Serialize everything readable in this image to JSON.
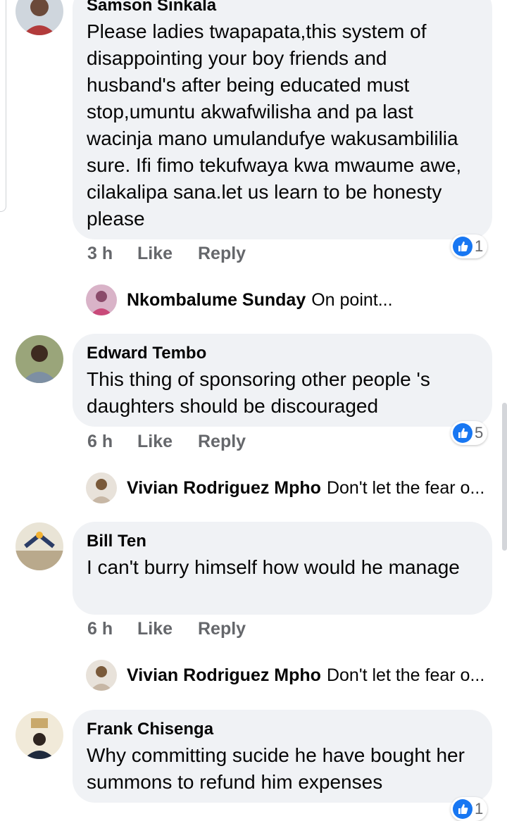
{
  "comments": [
    {
      "author": "Samson Sinkala",
      "text": "Please ladies twapapata,this system of disappointing your boy friends and husband's after being educated must stop,umuntu akwafwilisha and pa last wacinja mano umulandufye wakusambililia sure. Ifi fimo tekufwaya kwa mwaume awe, cilakalipa sana.let us learn to be honesty please",
      "time": "3 h",
      "like": "Like",
      "reply": "Reply",
      "reactions": "1",
      "reply_preview": {
        "name": "Nkombalume Sunday",
        "text": "On point..."
      }
    },
    {
      "author": "Edward Tembo",
      "text": "This thing of sponsoring other people 's daughters should be discouraged",
      "time": "6 h",
      "like": "Like",
      "reply": "Reply",
      "reactions": "5",
      "reply_preview": {
        "name": "Vivian Rodriguez Mpho",
        "text": "Don't let the fear o..."
      }
    },
    {
      "author": "Bill Ten",
      "text": "I can't burry himself how would he manage",
      "time": "6 h",
      "like": "Like",
      "reply": "Reply",
      "reply_preview": {
        "name": "Vivian Rodriguez Mpho",
        "text": "Don't let the fear o..."
      }
    },
    {
      "author": "Frank Chisenga",
      "text": "Why committing sucide he have bought her summons to refund him expenses",
      "reactions": "1"
    }
  ],
  "colors": {
    "bubble": "#f0f2f5",
    "meta": "#65676b",
    "like_blue": "#1877f2"
  },
  "icons": {
    "reaction": "like-thumb-icon"
  }
}
